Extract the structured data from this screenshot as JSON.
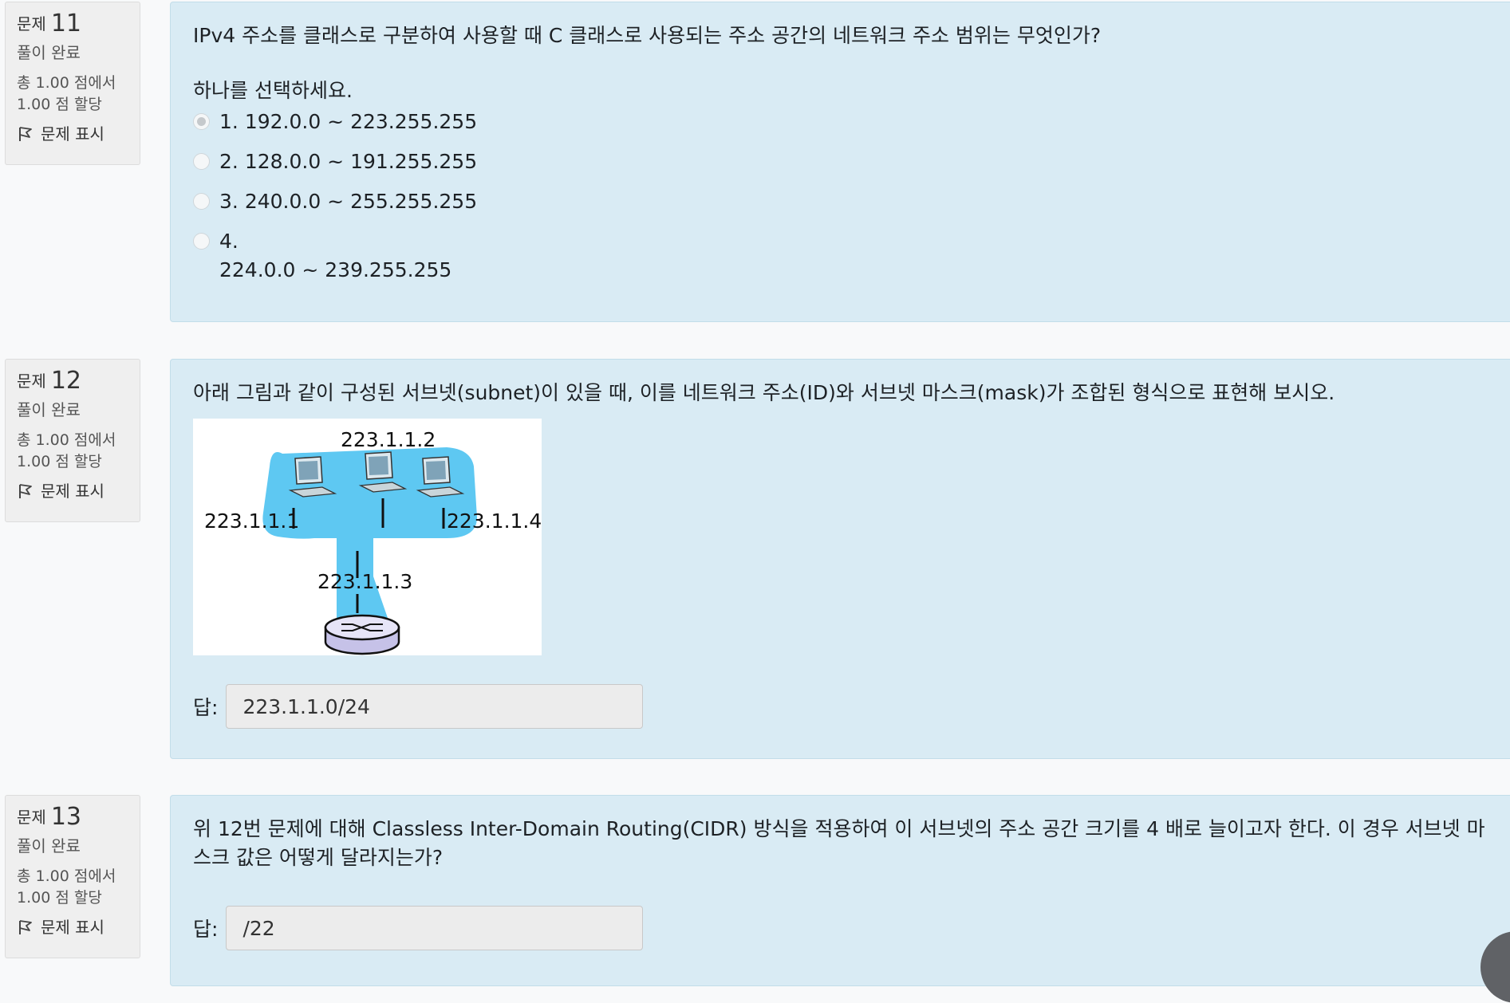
{
  "questions": [
    {
      "label": "문제",
      "number": "11",
      "state": "풀이 완료",
      "grade_line1": "총 1.00 점에서",
      "grade_line2": "1.00 점 할당",
      "flag_label": "문제 표시",
      "text": "IPv4 주소를 클래스로 구분하여 사용할 때 C 클래스로 사용되는 주소 공간의 네트워크 주소 범위는 무엇인가?",
      "prompt": "하나를 선택하세요.",
      "options": [
        {
          "number": "1.",
          "text": "192.0.0 ~ 223.255.255",
          "selected": true
        },
        {
          "number": "2.",
          "text": "128.0.0 ~ 191.255.255",
          "selected": false
        },
        {
          "number": "3.",
          "text": "240.0.0 ~ 255.255.255",
          "selected": false
        },
        {
          "number": "4.",
          "text": "224.0.0 ~ 239.255.255",
          "selected": false
        }
      ]
    },
    {
      "label": "문제",
      "number": "12",
      "state": "풀이 완료",
      "grade_line1": "총 1.00 점에서",
      "grade_line2": "1.00 점 할당",
      "flag_label": "문제 표시",
      "text": "아래 그림과 같이 구성된 서브넷(subnet)이 있을 때, 이를 네트워크 주소(ID)와 서브넷 마스크(mask)가 조합된 형식으로 표현해 보시오.",
      "figure": {
        "host_labels": [
          "223.1.1.2",
          "223.1.1.1",
          "223.1.1.4",
          "223.1.1.3"
        ]
      },
      "answer_label": "답:",
      "answer_value": "223.1.1.0/24"
    },
    {
      "label": "문제",
      "number": "13",
      "state": "풀이 완료",
      "grade_line1": "총 1.00 점에서",
      "grade_line2": "1.00 점 할당",
      "flag_label": "문제 표시",
      "text": "위 12번 문제에 대해 Classless Inter-Domain Routing(CIDR) 방식을 적용하여 이 서브넷의 주소 공간 크기를 4 배로 늘이고자 한다. 이 경우 서브넷 마스크 값은 어떻게 달라지는가?",
      "answer_label": "답:",
      "answer_value": "/22"
    }
  ],
  "colors": {
    "content_bg": "#d9ebf4",
    "info_bg": "#efefef",
    "cloud": "#5ec8f2"
  }
}
